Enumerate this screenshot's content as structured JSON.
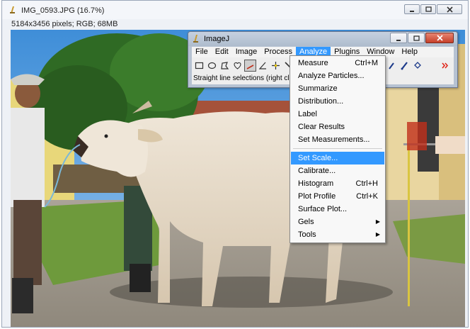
{
  "image_window": {
    "title": "IMG_0593.JPG (16.7%)",
    "info": "5184x3456 pixels; RGB; 68MB"
  },
  "imagej": {
    "title": "ImageJ",
    "menus": [
      "File",
      "Edit",
      "Image",
      "Process",
      "Analyze",
      "Plugins",
      "Window",
      "Help"
    ],
    "active_menu": "Analyze",
    "status": "Straight line selections (right click f"
  },
  "analyze_menu": {
    "items": [
      {
        "label": "Measure",
        "shortcut": "Ctrl+M"
      },
      {
        "label": "Analyze Particles...",
        "shortcut": ""
      },
      {
        "label": "Summarize",
        "shortcut": ""
      },
      {
        "label": "Distribution...",
        "shortcut": ""
      },
      {
        "label": "Label",
        "shortcut": ""
      },
      {
        "label": "Clear Results",
        "shortcut": ""
      },
      {
        "label": "Set Measurements...",
        "shortcut": ""
      },
      {
        "label": "Set Scale...",
        "shortcut": ""
      },
      {
        "label": "Calibrate...",
        "shortcut": ""
      },
      {
        "label": "Histogram",
        "shortcut": "Ctrl+H"
      },
      {
        "label": "Plot Profile",
        "shortcut": "Ctrl+K"
      },
      {
        "label": "Surface Plot...",
        "shortcut": ""
      },
      {
        "label": "Gels",
        "shortcut": ""
      },
      {
        "label": "Tools",
        "shortcut": ""
      }
    ],
    "highlighted": "Set Scale..."
  },
  "icons": [
    "imagej-app-icon",
    "minimize-icon",
    "maximize-icon",
    "close-icon",
    "rectangle-tool-icon",
    "oval-tool-icon",
    "polygon-tool-icon",
    "freehand-tool-icon",
    "straight-line-tool-icon",
    "angle-tool-icon",
    "point-tool-icon",
    "wand-tool-icon",
    "dropper-tool-icon",
    "brush-tool-icon",
    "flood-fill-tool-icon",
    "more-tools-icon",
    "submenu-arrow-icon"
  ],
  "colors": {
    "menu_highlight": "#3399ff",
    "more_tools": "#e0281c"
  }
}
